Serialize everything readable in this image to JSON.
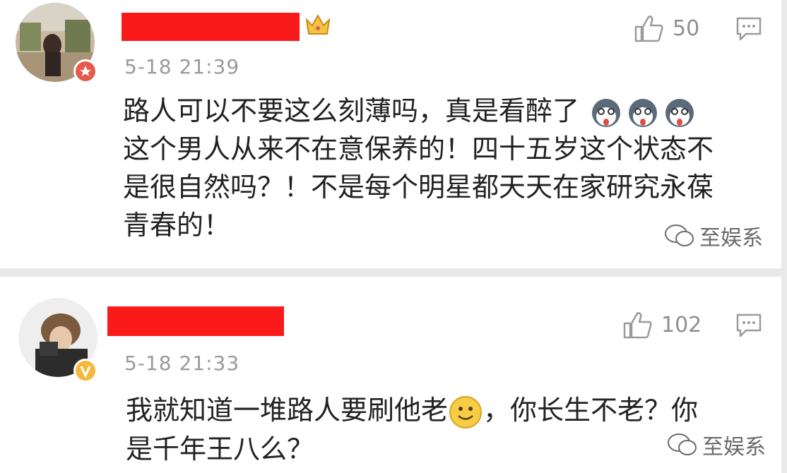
{
  "comments": [
    {
      "timestamp": "5-18 21:39",
      "like_count": "50",
      "text_lines": [
        "路人可以不要这么刻薄吗，真是看醉了",
        "这个男人从来不在意保养的！四十五岁这个状态不",
        "是很自然吗？！不是每个明星都天天在家研究永葆",
        "青春的！"
      ],
      "badge_color": "#e45b4b"
    },
    {
      "timestamp": "5-18 21:33",
      "like_count": "102",
      "text_lines": [
        "我就知道一堆路人要刷他老",
        "，你长生不老？你",
        "是千年王八么？"
      ],
      "badge_color": "#f4b93c"
    }
  ],
  "watermark": "至娱系",
  "icons": {
    "like": "thumbs-up-icon",
    "reply": "comment-icon",
    "emoji": "husky-emoji-icon",
    "smile": "smile-emoji-icon",
    "crown": "crown-icon"
  }
}
